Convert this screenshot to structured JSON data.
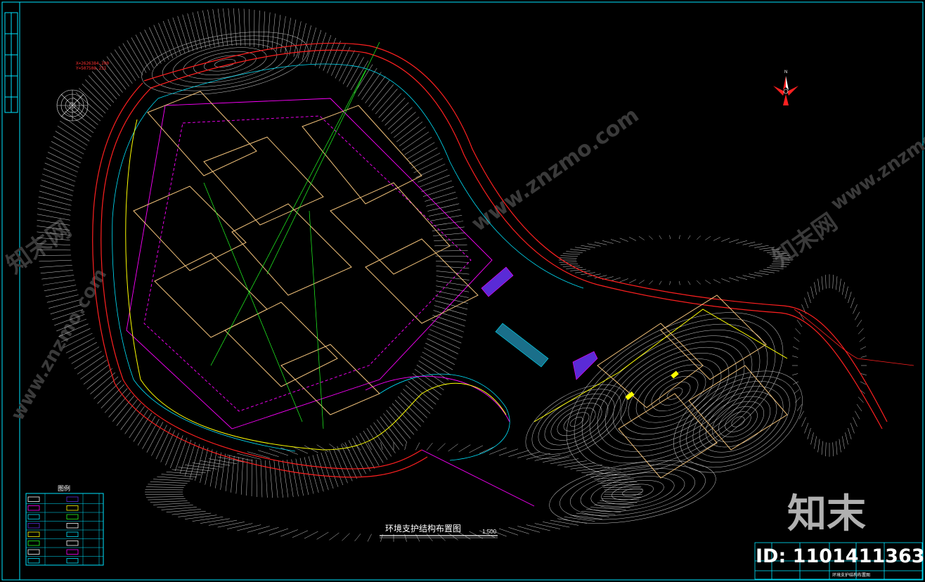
{
  "plan": {
    "title": "环境支护结构布置图",
    "scale": "1:500"
  },
  "legend": {
    "heading": "图例",
    "rows": 8
  },
  "north_arrow": {
    "label": "N"
  },
  "coordinates": [
    "X=2626384.200",
    "Y=507508.231"
  ],
  "watermark": {
    "brand": "知末",
    "id_text": "ID: 1101411363",
    "site": "www.znzmo.com",
    "faint_brand": "知末网"
  },
  "title_block": {
    "sheet_label": "环境支护结构布置图"
  },
  "colors": {
    "frame": "#00e5ff",
    "contour": "#d9d9d9",
    "road": "#ff2020",
    "building": "#f2c27a",
    "magenta": "#ff00ff",
    "green": "#22ff22",
    "yellow": "#ffff00",
    "cyan": "#00e5ff"
  }
}
